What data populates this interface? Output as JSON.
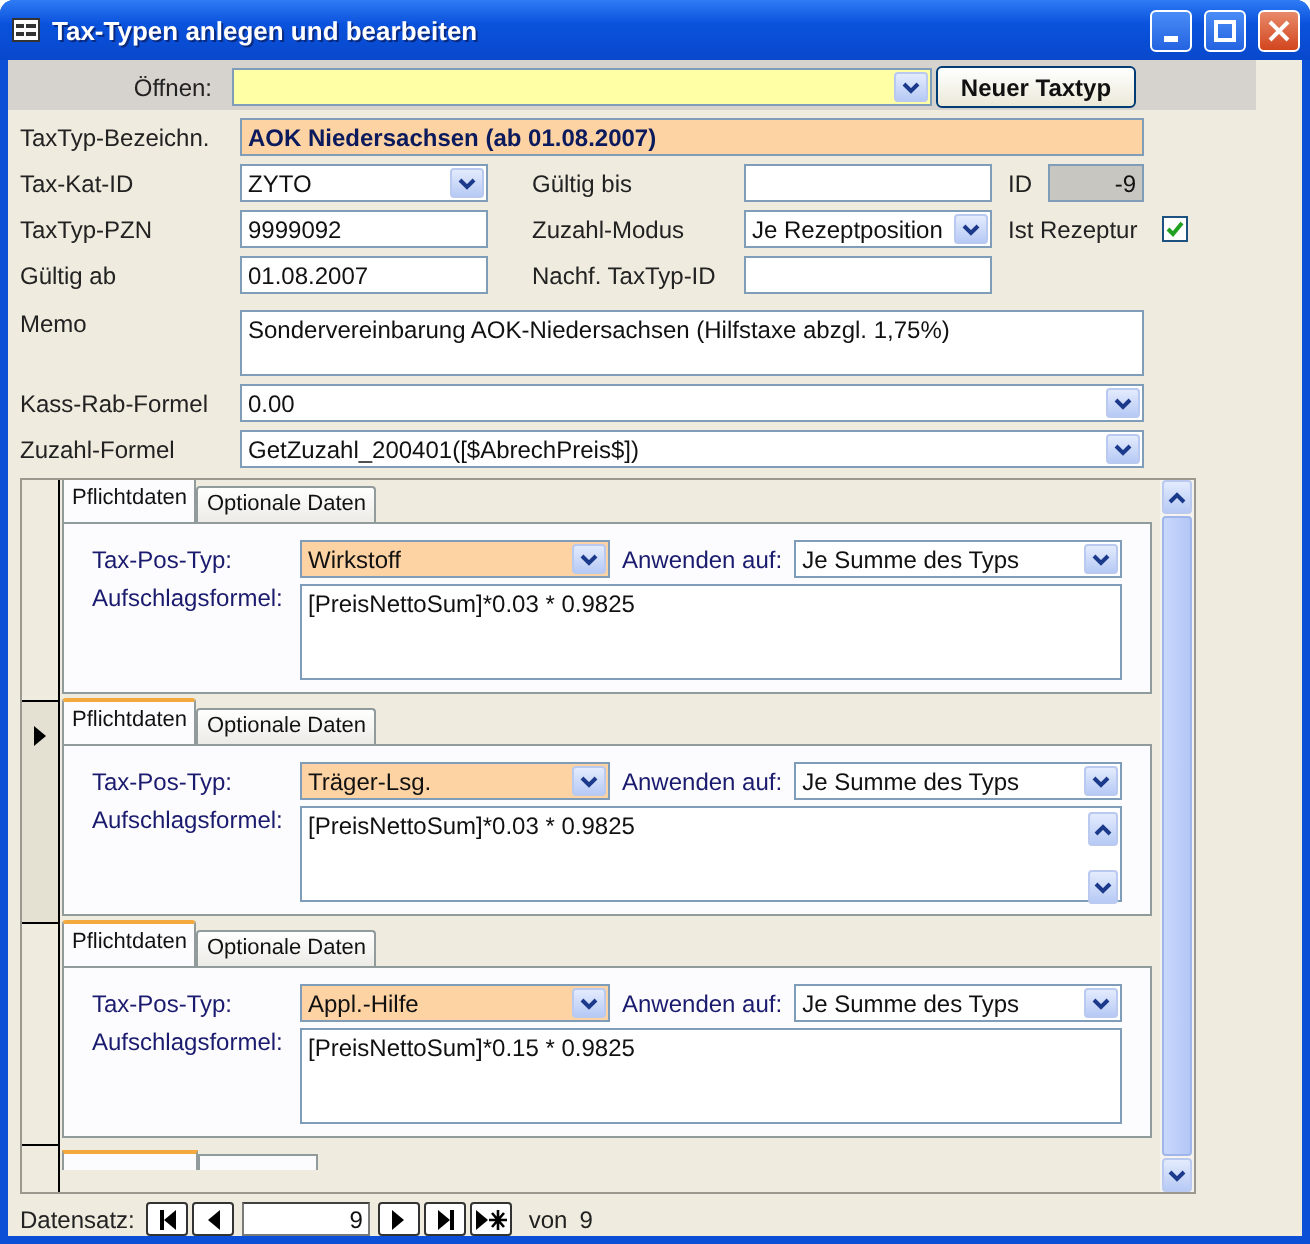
{
  "window": {
    "title": "Tax-Typen anlegen und bearbeiten"
  },
  "open": {
    "label": "Öffnen:",
    "button": "Neuer Taxtyp"
  },
  "name": {
    "label": "TaxTyp-Bezeichn.",
    "value": "AOK Niedersachsen (ab 01.08.2007)"
  },
  "rows": [
    {
      "cells": [
        {
          "kind": "combo",
          "label": "Tax-Kat-ID",
          "value": "ZYTO"
        },
        {
          "kind": "text",
          "label": "Gültig bis"
        },
        {
          "kind": "readonly",
          "label": "ID",
          "value": "-9"
        }
      ]
    },
    {
      "cells": [
        {
          "kind": "text",
          "label": "TaxTyp-PZN",
          "value": "9999092"
        },
        {
          "kind": "combo",
          "label": "Zuzahl-Modus",
          "value": "Je Rezeptposition"
        },
        {
          "kind": "check",
          "label": "Ist Rezeptur",
          "checked": true
        }
      ]
    },
    {
      "cells": [
        {
          "kind": "text",
          "label": "Gültig ab",
          "value": "01.08.2007"
        },
        {
          "kind": "text",
          "label": "Nachf. TaxTyp-ID"
        }
      ]
    }
  ],
  "memo": {
    "label": "Memo",
    "value": "Sondervereinbarung AOK-Niedersachsen (Hilfstaxe abzgl. 1,75%)"
  },
  "formulas": [
    {
      "label": "Kass-Rab-Formel",
      "value": "0.00"
    },
    {
      "label": "Zuzahl-Formel",
      "value": "GetZuzahl_200401([$AbrechPreis$])"
    }
  ],
  "subform": {
    "more_below": true,
    "records": [
      {
        "current": false,
        "tabs": [
          {
            "label": "Pflichtdaten",
            "selected": true
          },
          {
            "label": "Optionale Daten",
            "selected": false
          }
        ],
        "pos_type_label": "Tax-Pos-Typ:",
        "pos_type": "Wirkstoff",
        "apply_label": "Anwenden auf:",
        "apply": "Je Summe des Typs",
        "formula_label": "Aufschlagsformel:",
        "formula": "[PreisNettoSum]*0.03 * 0.9825",
        "formula_scrollbar": false
      },
      {
        "current": true,
        "tabs": [
          {
            "label": "Pflichtdaten",
            "selected": true
          },
          {
            "label": "Optionale Daten",
            "selected": false
          }
        ],
        "pos_type_label": "Tax-Pos-Typ:",
        "pos_type": "Träger-Lsg.",
        "apply_label": "Anwenden auf:",
        "apply": "Je Summe des Typs",
        "formula_label": "Aufschlagsformel:",
        "formula": "[PreisNettoSum]*0.03 * 0.9825",
        "formula_scrollbar": true
      },
      {
        "current": false,
        "tabs": [
          {
            "label": "Pflichtdaten",
            "selected": true
          },
          {
            "label": "Optionale Daten",
            "selected": false
          }
        ],
        "pos_type_label": "Tax-Pos-Typ:",
        "pos_type": "Appl.-Hilfe",
        "apply_label": "Anwenden auf:",
        "apply": "Je Summe des Typs",
        "formula_label": "Aufschlagsformel:",
        "formula": "[PreisNettoSum]*0.15 * 0.9825",
        "formula_scrollbar": false
      }
    ]
  },
  "navigator": {
    "label": "Datensatz:",
    "current": "9",
    "of_label": "von",
    "total": "9"
  }
}
